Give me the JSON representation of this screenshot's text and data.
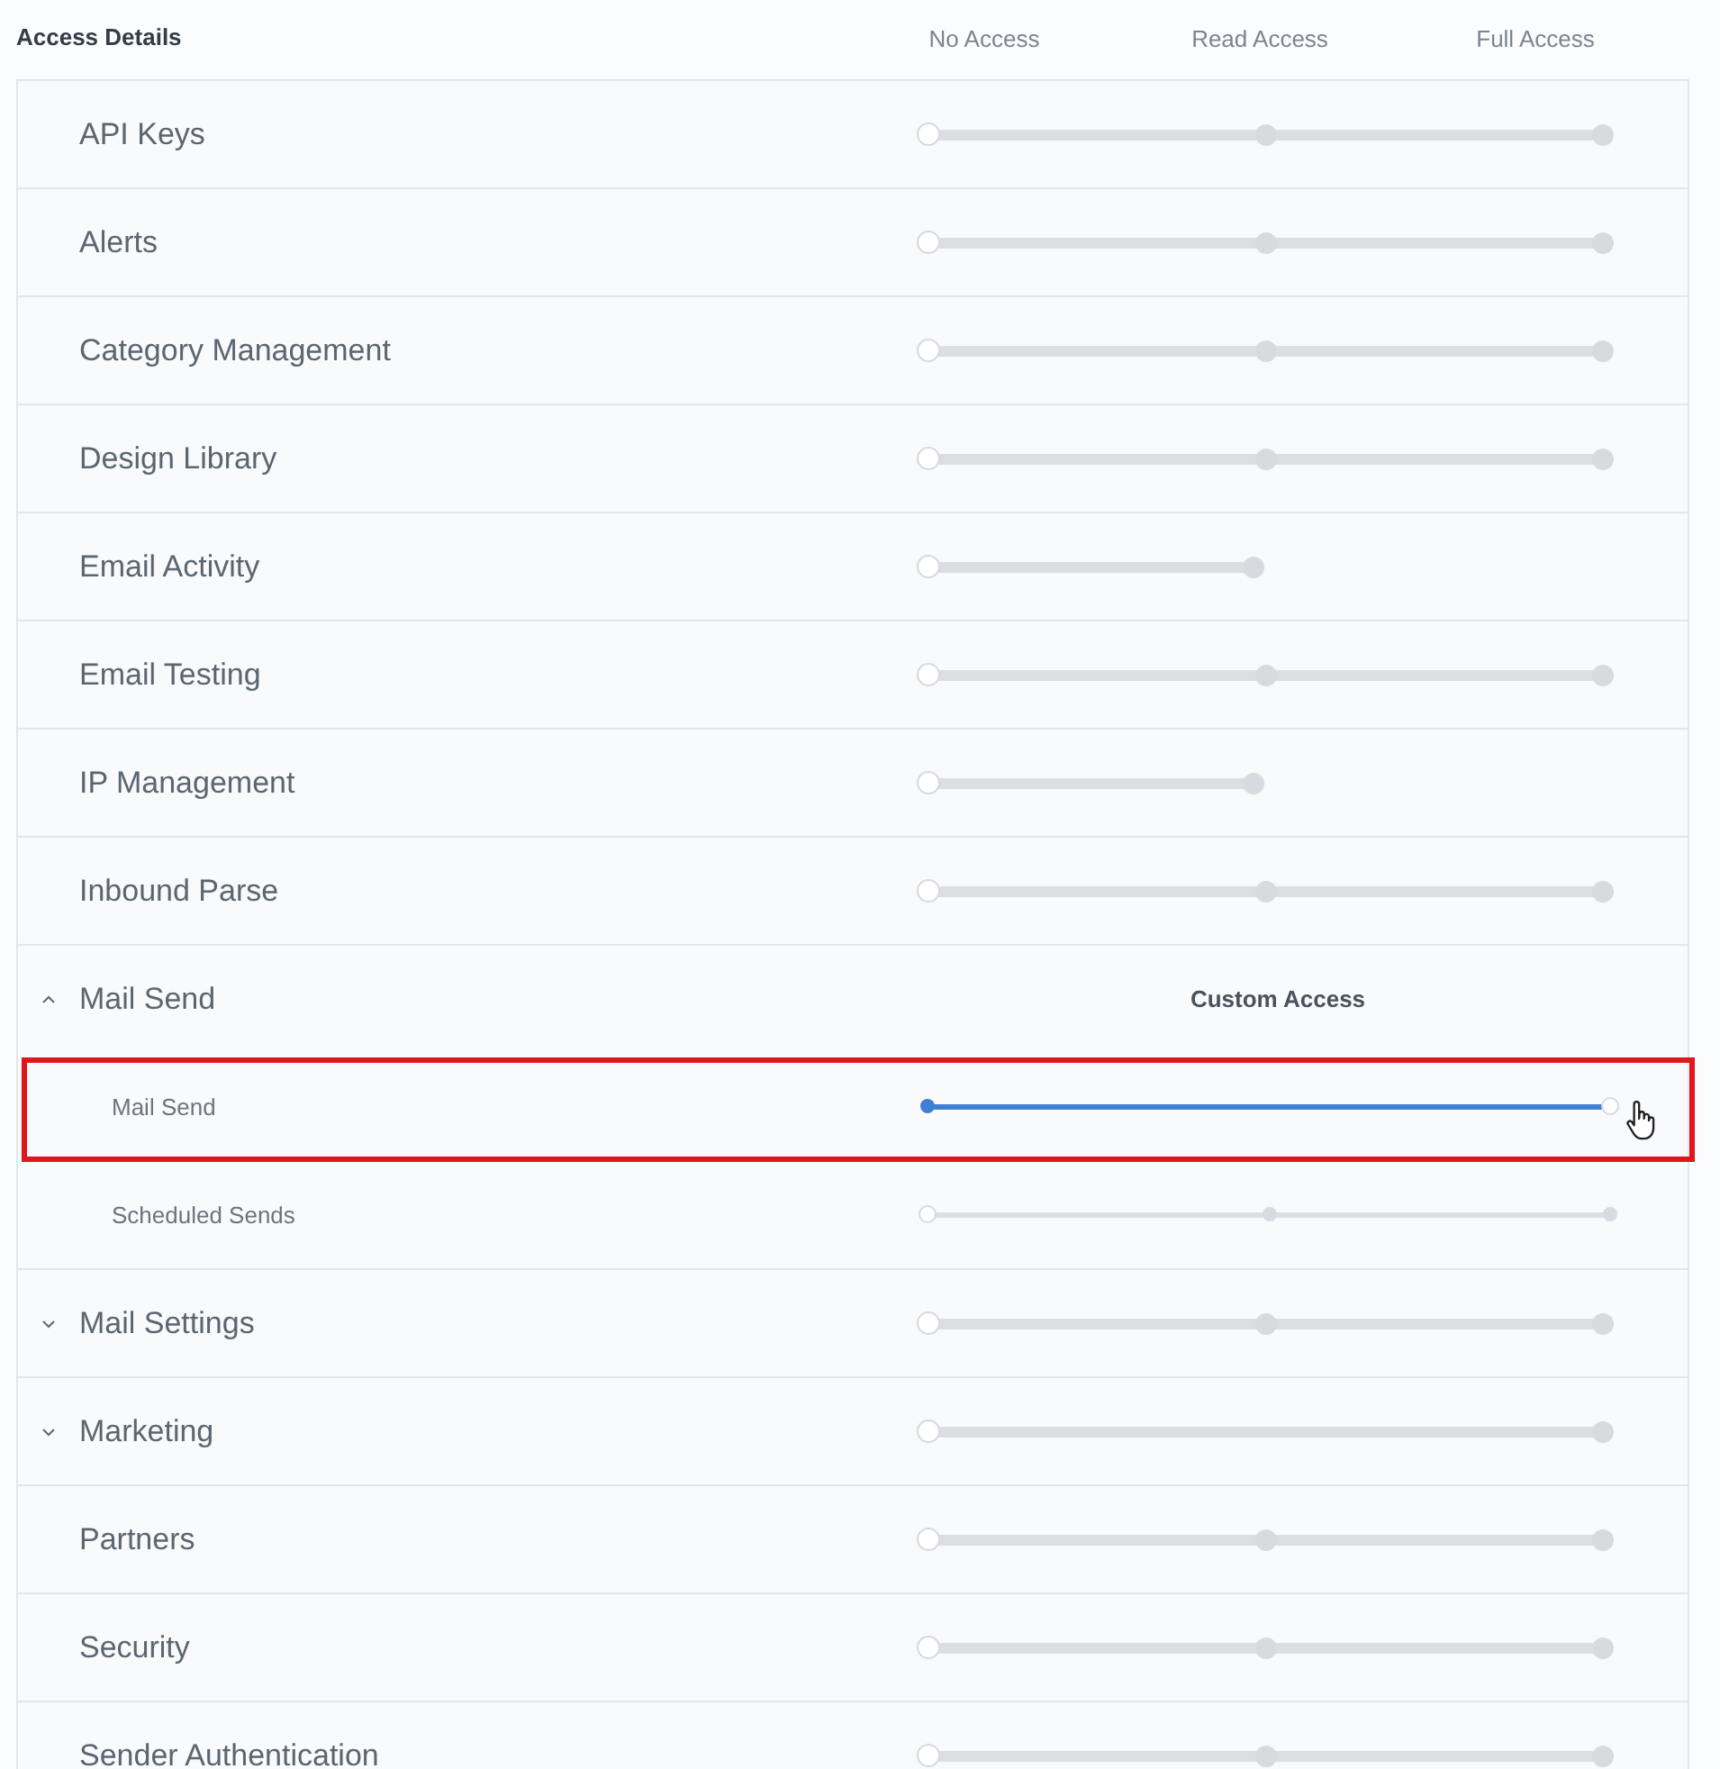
{
  "header": {
    "title": "Access Details",
    "levels": [
      "No Access",
      "Read Access",
      "Full Access"
    ]
  },
  "rows": [
    {
      "label": "API Keys",
      "kind": "full",
      "level": 0
    },
    {
      "label": "Alerts",
      "kind": "full",
      "level": 0
    },
    {
      "label": "Category Management",
      "kind": "full",
      "level": 0
    },
    {
      "label": "Design Library",
      "kind": "full",
      "level": 0
    },
    {
      "label": "Email Activity",
      "kind": "read",
      "level": 0
    },
    {
      "label": "Email Testing",
      "kind": "full",
      "level": 0
    },
    {
      "label": "IP Management",
      "kind": "read",
      "level": 0
    },
    {
      "label": "Inbound Parse",
      "kind": "full",
      "level": 0
    },
    {
      "label": "Mail Send",
      "kind": "custom",
      "expanded": true,
      "custom_label": "Custom Access",
      "children": [
        {
          "label": "Mail Send",
          "kind": "no-read",
          "level": 1,
          "highlighted": true,
          "pointer": true
        },
        {
          "label": "Scheduled Sends",
          "kind": "full",
          "level": 0,
          "highlighted": false,
          "pointer": false
        }
      ]
    },
    {
      "label": "Mail Settings",
      "kind": "full",
      "level": 0,
      "expanded": false
    },
    {
      "label": "Marketing",
      "kind": "no-read",
      "level": 0,
      "expanded": false
    },
    {
      "label": "Partners",
      "kind": "full",
      "level": 0
    },
    {
      "label": "Security",
      "kind": "full",
      "level": 0
    },
    {
      "label": "Sender Authentication",
      "kind": "full",
      "level": 0
    }
  ]
}
